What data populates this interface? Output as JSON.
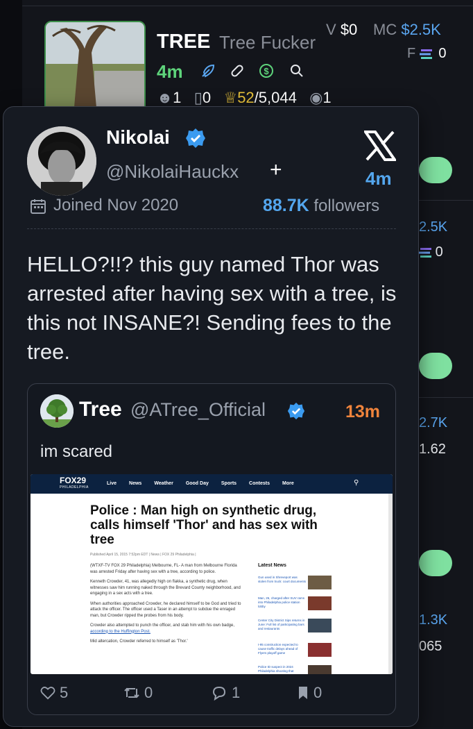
{
  "token": {
    "ticker": "TREE",
    "name": "Tree Fucker",
    "volume_label": "V",
    "volume_value": "$0",
    "mc_label": "MC",
    "mc_value": "$2.5K",
    "fee_label": "F",
    "fee_value": "0",
    "age": "4m",
    "holders": "1",
    "snipers": "0",
    "top_holders": "52",
    "top_holders_total": "/5,044",
    "watchers": "1",
    "accent_green": "#5ed37b",
    "accent_blue": "#5aa6f0"
  },
  "background_rows": {
    "row2_mc": "2.5K",
    "row2_fee": "0",
    "row3_mc": "2.7K",
    "row3_val": "1.62",
    "row4_mc": "1.3K",
    "row4_val": "065"
  },
  "tweet": {
    "author_name": "Nikolai",
    "handle": "@NikolaiHauckx",
    "plus": "+",
    "time": "4m",
    "joined": "Joined Nov 2020",
    "followers_count": "88.7K",
    "followers_label": "followers",
    "text": "HELLO?!!? this guy named Thor was arrested after having sex with a tree, is this not INSANE?! Sending fees to the tree.",
    "icons": [
      "verified-badge-icon",
      "x-logo-icon",
      "calendar-icon"
    ]
  },
  "quote": {
    "name": "Tree",
    "handle": "@ATree_Official",
    "time": "13m",
    "text": "im scared",
    "likes": "5",
    "retweets": "0",
    "replies": "1",
    "bookmarks": "0"
  },
  "article": {
    "site_logo": "FOX29",
    "site_sub": "PHILADELPHIA",
    "nav": [
      "Live",
      "News",
      "Weather",
      "Good Day",
      "Sports",
      "Contests",
      "More"
    ],
    "title": "Police : Man high on synthetic drug, calls himself 'Thor' and has sex with tree",
    "meta": "Published April 15, 2015 7:52pm EDT | News | FOX 29 Philadelphia |",
    "paragraphs": [
      "(WTXF-TV FOX 29 Philadelphia) Melbourne, FL- A man from Melbourne Florida was arrested Friday after having sex with a tree, according to police.",
      "Kenneth Crowder, 41, was allegedly high on flakka, a synthetic drug, when witnesses saw him running naked through the Brevard County neighborhood, and engaging in a sex acts with a tree.",
      "When authorities approached Crowder, he declared himself to be God and tried to attack the officer. The officer used a Taser in an attempt to subdue the enraged man, but Crowder ripped the probes from his body.",
      "Crowder also attempted to punch the officer, and stab him with his own badge,",
      "Mid altercation, Crowder referred to himself as 'Thor.'"
    ],
    "link_text": "according to the Huffington Post.",
    "latest_title": "Latest News",
    "latest": [
      "Gun used in Shreveport was stolen from truck: court documents",
      "Man, 26, charged after SUV rams into Philadelphia police station lobby",
      "Center City District Sips returns in June: Full list of participating bars and restaurants",
      "I-95 construction expected to cause traffic delays ahead of Flyers playoff game",
      "Police ID suspect in 2024 Philadelphia shooting that"
    ]
  }
}
